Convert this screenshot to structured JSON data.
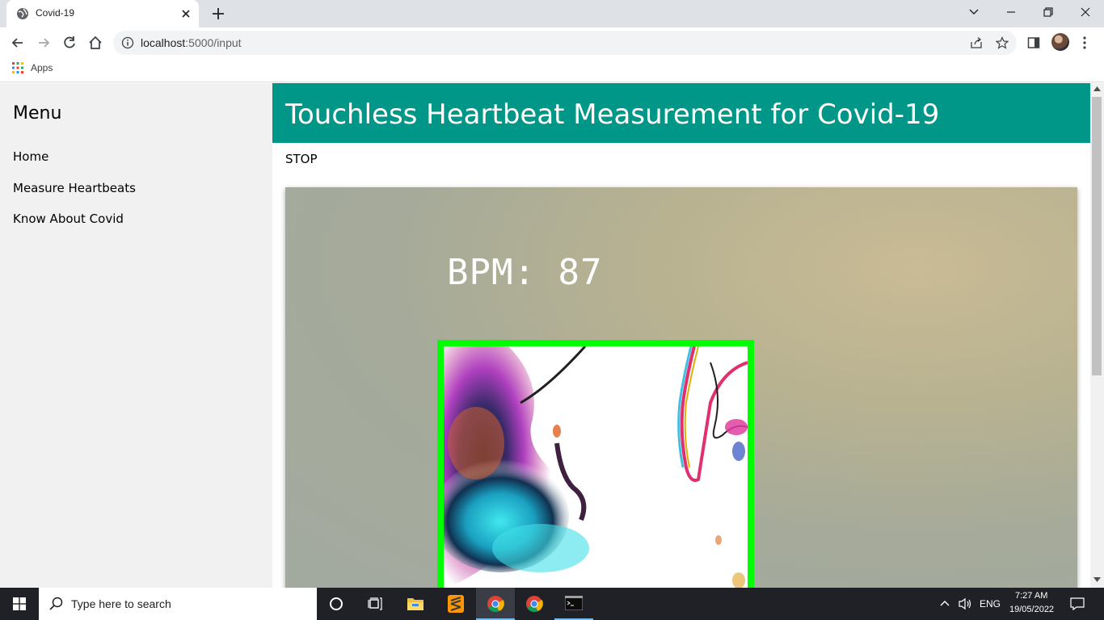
{
  "browser": {
    "tab_title": "Covid-19",
    "url_host": "localhost",
    "url_rest": ":5000/input",
    "bookmarks": {
      "apps_label": "Apps"
    }
  },
  "sidebar": {
    "title": "Menu",
    "items": [
      {
        "label": "Home"
      },
      {
        "label": "Measure Heartbeats"
      },
      {
        "label": "Know About Covid"
      }
    ]
  },
  "main": {
    "header_title": "Touchless Heartbeat Measurement for Covid-19",
    "stop_label": "STOP",
    "video": {
      "bpm_text": "BPM: 87"
    }
  },
  "taskbar": {
    "search_placeholder": "Type here to search",
    "tray": {
      "language": "ENG",
      "time": "7:27 AM",
      "date": "19/05/2022"
    }
  },
  "colors": {
    "header_bg": "#009688",
    "face_box": "#00ff00",
    "sidebar_bg": "#f1f1f1",
    "taskbar_bg": "#1f2127"
  },
  "icons": [
    "globe-icon",
    "close-icon",
    "plus-icon",
    "chevron-down-icon",
    "minimize-icon",
    "restore-icon",
    "back-icon",
    "forward-icon",
    "reload-icon",
    "home-icon",
    "info-icon",
    "share-icon",
    "star-icon",
    "side-panel-icon",
    "more-icon",
    "apps-grid-icon",
    "windows-logo-icon",
    "search-icon",
    "cortana-icon",
    "task-view-icon",
    "file-explorer-icon",
    "sublime-icon",
    "chrome-icon",
    "terminal-icon",
    "chevron-up-icon",
    "speaker-icon",
    "notification-icon"
  ]
}
